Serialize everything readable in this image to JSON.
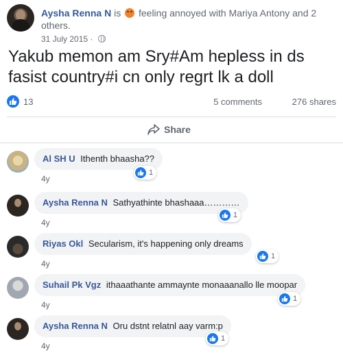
{
  "post": {
    "author": "Aysha Renna N",
    "feeling_prefix": "is",
    "feeling_text": "feeling annoyed with",
    "tagged": "Mariya Antony",
    "tagged_suffix": "and 2 others.",
    "date": "31 July 2015",
    "body": "Yakub memon am Sry#Am hepless in ds fasist country#i cn only regrt lk a doll",
    "reaction_count": "13",
    "comments_count": "5 comments",
    "shares_count": "276 shares",
    "share_label": "Share",
    "colors": {
      "link": "#385898",
      "like_blue": "#1877f2",
      "angry_emoji": "#f0832e"
    },
    "icons": {
      "privacy": "globe-icon",
      "feeling": "angry-emoji-icon",
      "share": "share-arrow-icon",
      "reaction": "like-icon"
    }
  },
  "comments": [
    {
      "name": "Al SH U",
      "text": "Ithenth bhaasha??",
      "age": "4y",
      "likes": "1"
    },
    {
      "name": "Aysha Renna N",
      "text": "Sathyathinte bhashaaa…………",
      "age": "4y",
      "likes": "1"
    },
    {
      "name": "Riyas Okl",
      "text": "Secularism, it's happening only dreams",
      "age": "4y",
      "likes": "1"
    },
    {
      "name": "Suhail Pk Vgz",
      "text": "ithaaathante ammaynte monaaanallo lle moopar",
      "age": "4y",
      "likes": "1"
    },
    {
      "name": "Aysha Renna N",
      "text": "Oru dstnt relatnl aay varm:p",
      "age": "4y",
      "likes": "1"
    }
  ]
}
